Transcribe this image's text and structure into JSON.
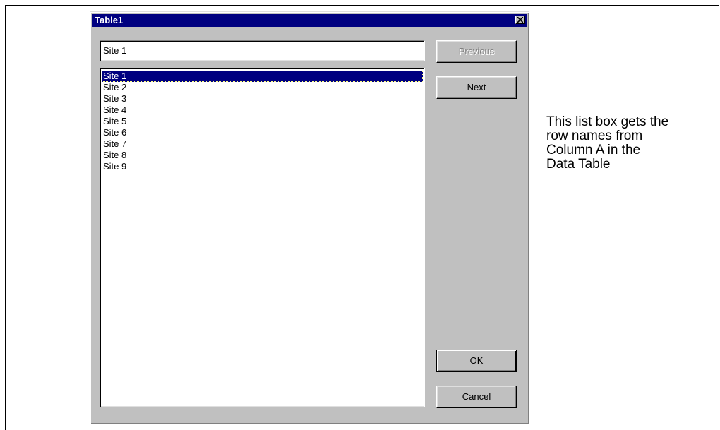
{
  "dialog": {
    "title": "Table1",
    "close_icon": "close-icon",
    "textbox_value": "Site 1",
    "list_items": [
      "Site 1",
      "Site 2",
      "Site 3",
      "Site 4",
      "Site 5",
      "Site 6",
      "Site 7",
      "Site 8",
      "Site 9"
    ],
    "selected_index": 0,
    "buttons": {
      "previous": "Previous",
      "next": "Next",
      "ok": "OK",
      "cancel": "Cancel"
    }
  },
  "annotation": {
    "lines": [
      "This list box gets the",
      "row names from",
      "Column A in the",
      "Data Table"
    ]
  },
  "colors": {
    "titlebar": "#000080",
    "face": "#c0c0c0",
    "selection": "#000080"
  }
}
